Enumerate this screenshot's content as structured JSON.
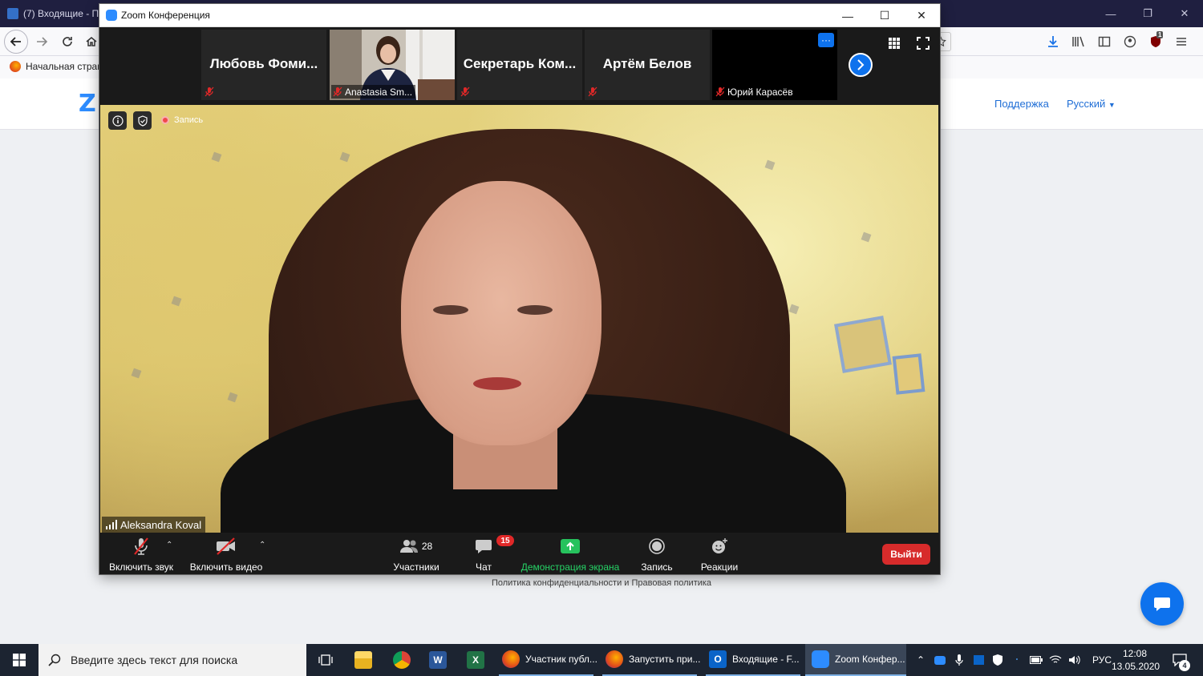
{
  "browser": {
    "tab_title": "(7) Входящие - П",
    "bookmark_home": "Начальная стран",
    "site_support": "Поддержка",
    "site_language": "Русский",
    "site_footer": "Политика конфиденциальности и Правовая политика",
    "ublock_count": "1"
  },
  "zoom": {
    "window_title": "Zoom Конференция",
    "thumbnails": [
      {
        "name": "Любовь Фоми...",
        "label": "",
        "muted": true,
        "video": false
      },
      {
        "name": "",
        "label": "Anastasia Sm...",
        "muted": true,
        "video": true
      },
      {
        "name": "Секретарь Ком...",
        "label": "",
        "muted": true,
        "video": false
      },
      {
        "name": "Артём Белов",
        "label": "",
        "muted": true,
        "video": false
      },
      {
        "name": "",
        "label": "Юрий Карасёв",
        "muted": true,
        "video": true
      }
    ],
    "thumb_more": "···",
    "recording_label": "Запись",
    "active_speaker": "Aleksandra Koval",
    "toolbar": {
      "audio_label": "Включить звук",
      "video_label": "Включить видео",
      "participants_label": "Участники",
      "participants_count": "28",
      "chat_label": "Чат",
      "chat_badge": "15",
      "share_label": "Демонстрация экрана",
      "record_label": "Запись",
      "reactions_label": "Реакции",
      "leave_label": "Выйти"
    },
    "colors": {
      "accent": "#0e72ed",
      "share": "#26d366",
      "leave": "#d72b2b",
      "mute": "#e02828"
    }
  },
  "taskbar": {
    "search_placeholder": "Введите здесь текст для поиска",
    "apps": [
      {
        "label": "Участник публ..."
      },
      {
        "label": "Запустить при..."
      },
      {
        "label": "Входящие - F..."
      },
      {
        "label": "Zoom Конфер..."
      }
    ],
    "language": "РУС",
    "time": "12:08",
    "date": "13.05.2020",
    "notification_count": "4"
  }
}
